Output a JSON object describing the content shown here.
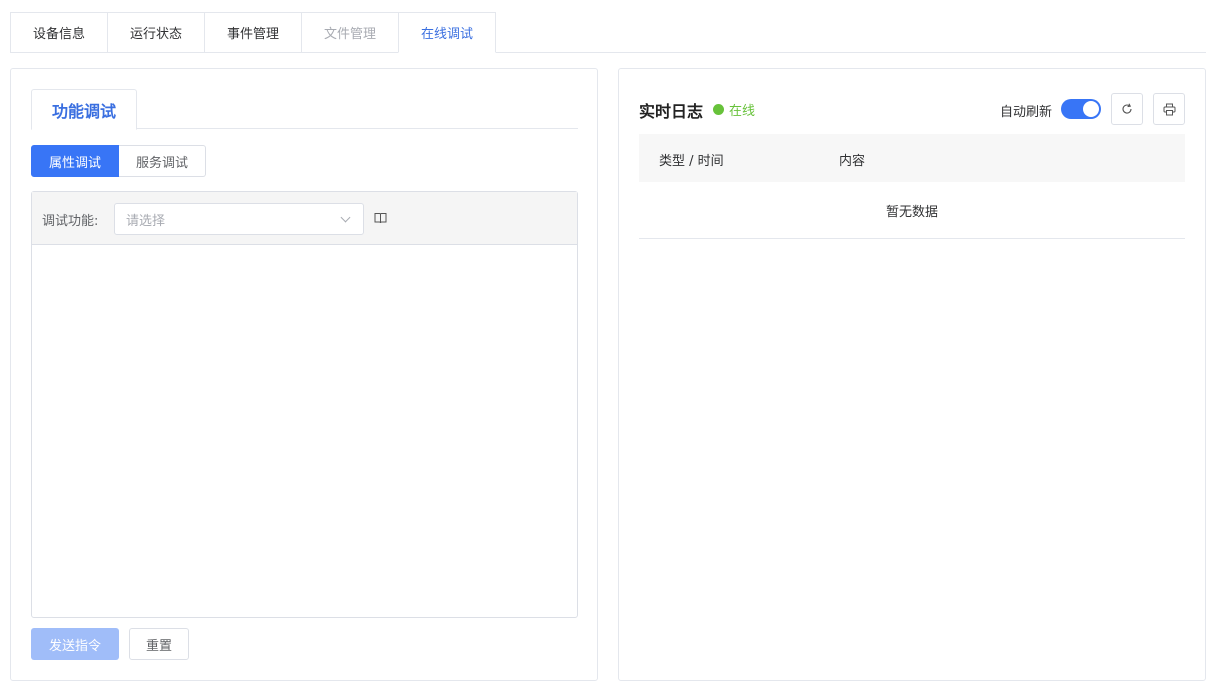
{
  "top_tabs": [
    {
      "label": "设备信息"
    },
    {
      "label": "运行状态"
    },
    {
      "label": "事件管理"
    },
    {
      "label": "文件管理"
    },
    {
      "label": "在线调试"
    }
  ],
  "left_panel": {
    "sub_tab": "功能调试",
    "segments": [
      "属性调试",
      "服务调试"
    ],
    "debug_label": "调试功能:",
    "select_placeholder": "请选择",
    "send_label": "发送指令",
    "reset_label": "重置"
  },
  "right_panel": {
    "title": "实时日志",
    "status": "在线",
    "auto_refresh_label": "自动刷新",
    "auto_refresh_on": true,
    "columns": [
      "类型 / 时间",
      "内容"
    ],
    "empty_text": "暂无数据"
  },
  "colors": {
    "accent": "#3875f6",
    "online": "#67c23a",
    "disabled_tab": "#a8abb2"
  }
}
